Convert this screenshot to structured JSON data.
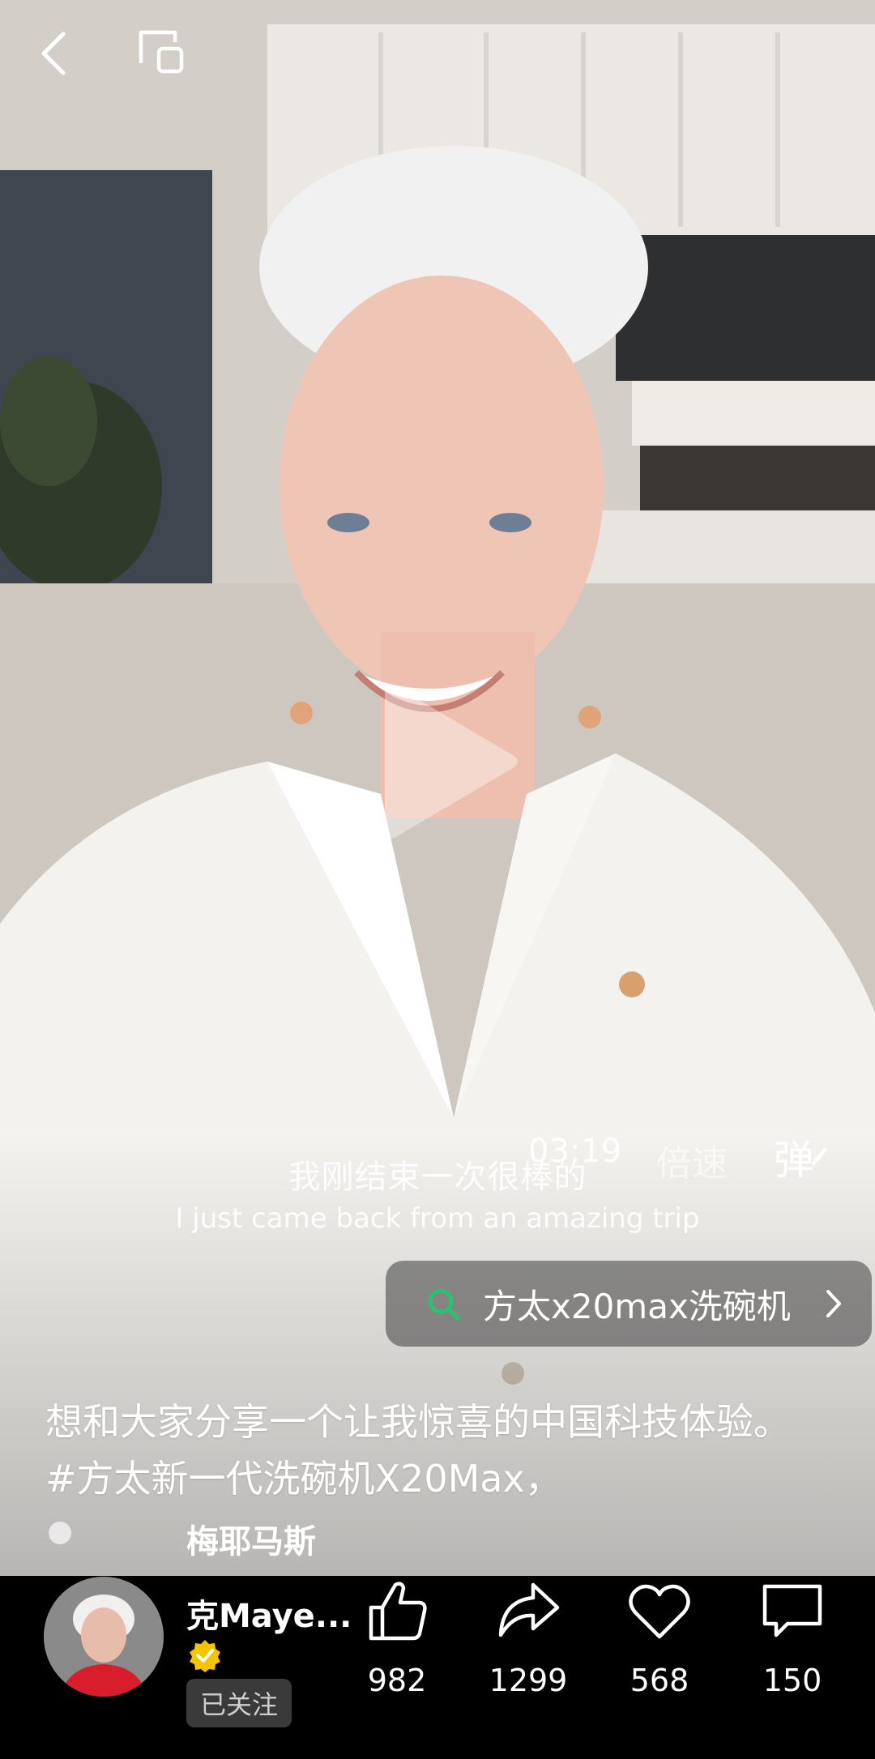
{
  "player": {
    "time": "03:19",
    "speed_label": "倍速",
    "danmaku_label": "弹"
  },
  "subtitles": {
    "chinese": "我刚结束一次很棒的",
    "english": "I just came back from an amazing trip"
  },
  "search": {
    "query": "方太x20max洗碗机"
  },
  "description": {
    "line1": "想和大家分享一个让我惊喜的中国科技体验。",
    "line2": "#方太新一代洗碗机X20Max，"
  },
  "author": {
    "name_line1": "梅耶马斯",
    "name_line2": "克Maye...",
    "follow_status": "已关注",
    "verified_color": "#f5c400"
  },
  "actions": {
    "like_count": "982",
    "share_count": "1299",
    "favorite_count": "568",
    "comment_count": "150"
  },
  "icons": {
    "back": "back-arrow-icon",
    "pip": "picture-in-picture-icon",
    "play": "play-icon",
    "search": "search-icon",
    "chevron": "chevron-right-icon",
    "like": "thumbs-up-icon",
    "share": "share-icon",
    "favorite": "heart-icon",
    "comment": "comment-icon"
  },
  "colors": {
    "accent_green": "#2fbf71",
    "bottom_bar": "#000000"
  }
}
